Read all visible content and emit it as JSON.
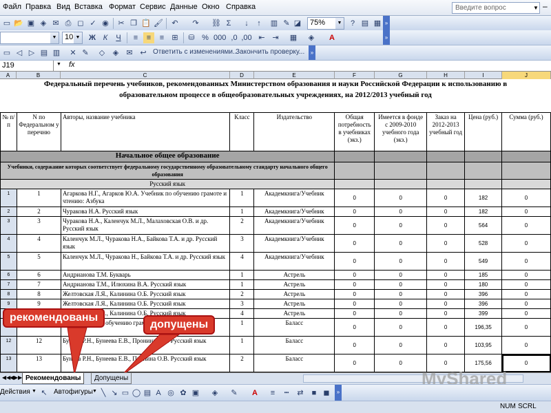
{
  "menu": [
    "Файл",
    "Правка",
    "Вид",
    "Вставка",
    "Формат",
    "Сервис",
    "Данные",
    "Окно",
    "Справка"
  ],
  "help_placeholder": "Введите вопрос",
  "zoom": "75%",
  "font_size": "10",
  "review_toolbar": {
    "reply": "Ответить с изменениями...",
    "end": "Закончить проверку..."
  },
  "name_box": "J19",
  "fx": "fx",
  "columns": [
    "A",
    "B",
    "C",
    "D",
    "E",
    "F",
    "G",
    "H",
    "I",
    "J"
  ],
  "title_line1": "Федеральный перечень учебников, рекомендованных Министерством образования и науки Российской Федерации к использованию в",
  "title_line2": "образовательном процессе в общеобразовательных учреждениях, на 2012/2013 учебный год",
  "headers": {
    "num": "№ п/п",
    "fed_num": "N по Федеральном у перечню",
    "authors": "Авторы, название учебника",
    "grade": "Класс",
    "publisher": "Издательство",
    "need": "Общая потребность в учебниках (экз.)",
    "available": "Имеется в фонде с 2009-2010 учебного года (экз.)",
    "order": "Заказ на 2012-2013 учебный год",
    "price": "Цена (руб.)",
    "sum": "Сумма (руб.)"
  },
  "section1": "Начальное общее образование",
  "section2": "Учебники, содержание которых соответствует федеральному государственному образовательному стандарту начального общего образования",
  "subject": "Русский язык",
  "rows": [
    {
      "n": "1",
      "fed": "1",
      "author": "Агаркова Н.Г., Агарков Ю.А. Учебник по обучению грамоте и чтению: Азбука",
      "grade": "1",
      "pub": "Академкнига/Учебник",
      "need": "0",
      "avail": "0",
      "order": "0",
      "price": "182",
      "sum": "0"
    },
    {
      "n": "2",
      "fed": "2",
      "author": "Чуракова Н.А. Русский язык",
      "grade": "1",
      "pub": "Академкнига/Учебник",
      "need": "0",
      "avail": "0",
      "order": "0",
      "price": "182",
      "sum": "0"
    },
    {
      "n": "3",
      "fed": "3",
      "author": "Чуракова Н.А., Каленчук М.Л., Малаховская О.В. и др. Русский язык",
      "grade": "2",
      "pub": "Академкнига/Учебник",
      "need": "0",
      "avail": "0",
      "order": "0",
      "price": "564",
      "sum": "0"
    },
    {
      "n": "4",
      "fed": "4",
      "author": "Каленчук М.Л., Чуракова Н.А., Байкова Т.А. и др. Русский язык",
      "grade": "3",
      "pub": "Академкнига/Учебник",
      "need": "0",
      "avail": "0",
      "order": "0",
      "price": "528",
      "sum": "0"
    },
    {
      "n": "5",
      "fed": "5",
      "author": "Каленчук М.Л., Чуракова Н., Байкова Т.А. и др. Русский язык",
      "grade": "4",
      "pub": "Академкнига/Учебник",
      "need": "0",
      "avail": "0",
      "order": "0",
      "price": "549",
      "sum": "0"
    },
    {
      "n": "6",
      "fed": "6",
      "author": "Андрианова Т.М. Букварь",
      "grade": "1",
      "pub": "Астрель",
      "need": "0",
      "avail": "0",
      "order": "0",
      "price": "185",
      "sum": "0"
    },
    {
      "n": "7",
      "fed": "7",
      "author": "Андрианова Т.М., Илюхина В.А. Русский язык",
      "grade": "1",
      "pub": "Астрель",
      "need": "0",
      "avail": "0",
      "order": "0",
      "price": "180",
      "sum": "0"
    },
    {
      "n": "8",
      "fed": "8",
      "author": "Желтовская Л.Я., Калинина О.Б. Русский язык",
      "grade": "2",
      "pub": "Астрель",
      "need": "0",
      "avail": "0",
      "order": "0",
      "price": "396",
      "sum": "0"
    },
    {
      "n": "9",
      "fed": "9",
      "author": "Желтовская Л.Я., Калинина О.Б. Русский язык",
      "grade": "3",
      "pub": "Астрель",
      "need": "0",
      "avail": "0",
      "order": "0",
      "price": "396",
      "sum": "0"
    },
    {
      "n": "10",
      "fed": "10",
      "author": "Желтовская Л.Я., Калинина О.Б. Русский язык",
      "grade": "4",
      "pub": "Астрель",
      "need": "0",
      "avail": "0",
      "order": "0",
      "price": "399",
      "sum": "0"
    },
    {
      "n": "11",
      "fed": "11",
      "author": "Бунеева Е.В., ... обучению грамоте и чтению",
      "grade": "1",
      "pub": "Баласс",
      "need": "0",
      "avail": "0",
      "order": "0",
      "price": "196,35",
      "sum": "0"
    },
    {
      "n": "12",
      "fed": "12",
      "author": "Бунеев Р.Н., Бунеева Е.В., Пронина О.В. Русский язык",
      "grade": "1",
      "pub": "Баласс",
      "need": "0",
      "avail": "0",
      "order": "0",
      "price": "103,95",
      "sum": "0"
    },
    {
      "n": "13",
      "fed": "13",
      "author": "Бунеев Р.Н., Бунеева Е.В., Пронина О.В. Русский язык",
      "grade": "2",
      "pub": "Баласс",
      "need": "0",
      "avail": "0",
      "order": "0",
      "price": "175,56",
      "sum": "0"
    }
  ],
  "tabs": [
    "Рекомендованы",
    "Допущены"
  ],
  "drawbar": {
    "actions": "Действия",
    "autoshapes": "Автофигуры"
  },
  "status": {
    "num": "NUM",
    "scrl": "SCRL"
  },
  "callouts": {
    "recommended": "рекомендованы",
    "allowed": "допущены"
  },
  "watermark": "MyShared",
  "colors": {
    "callout": "#d93a2b",
    "section_gray": "#a5a5a5"
  }
}
